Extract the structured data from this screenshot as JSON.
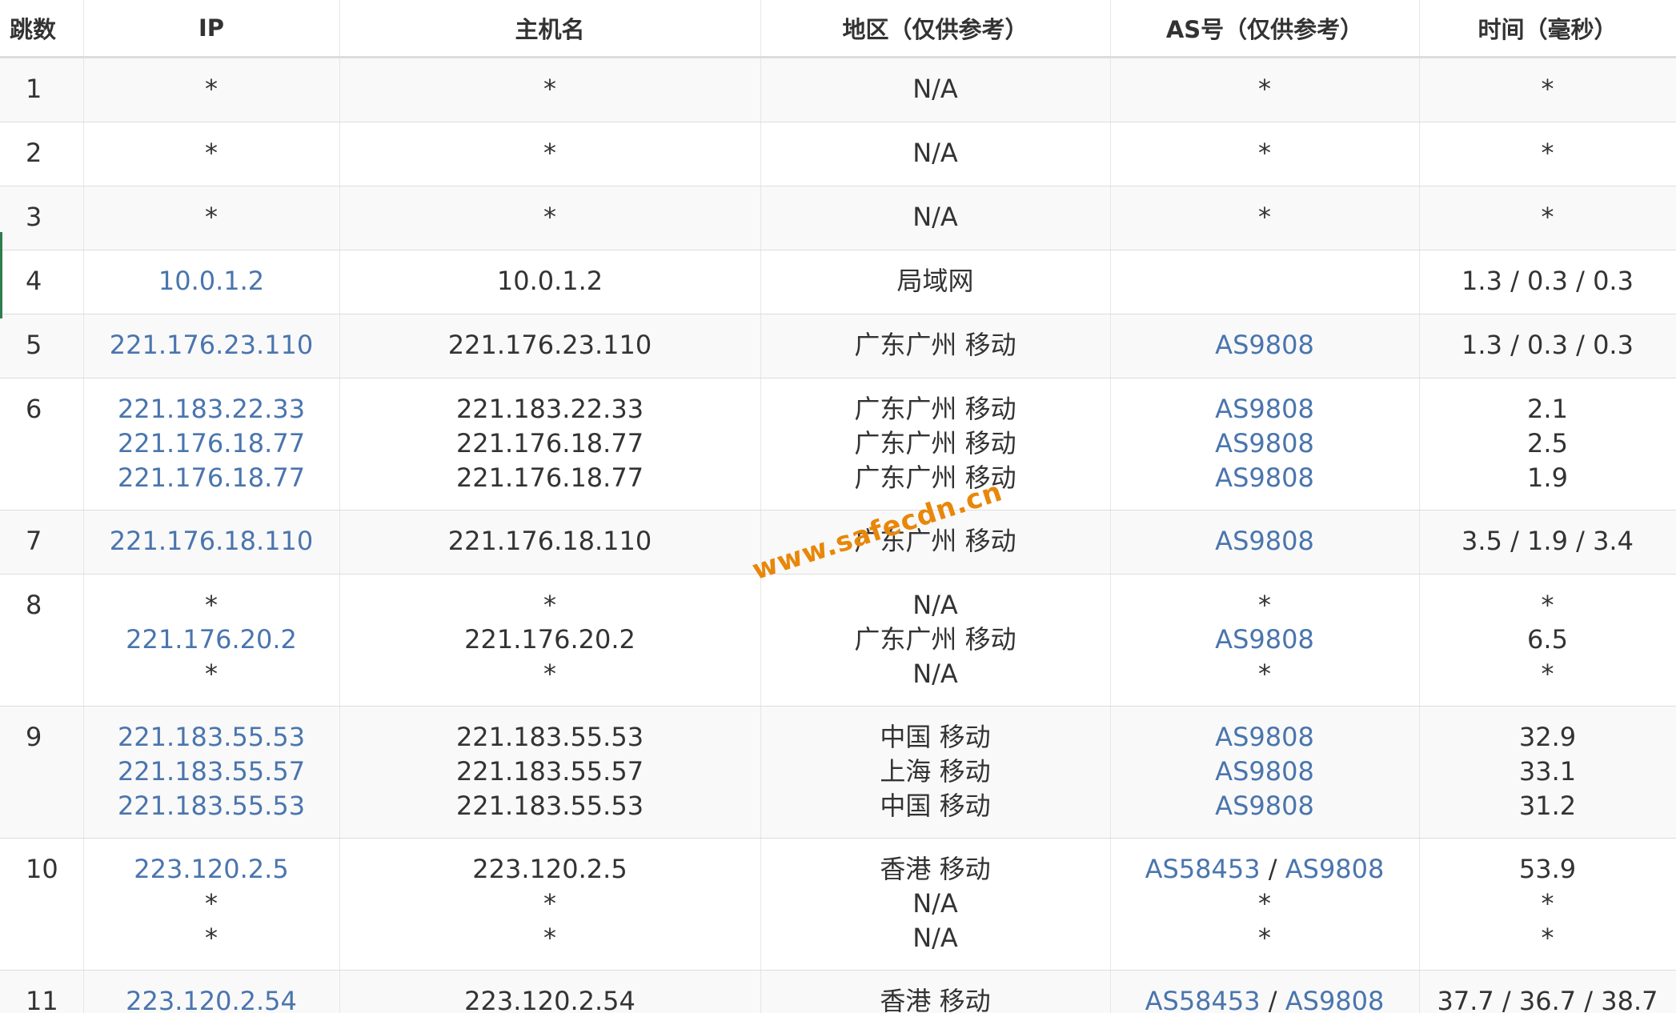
{
  "table": {
    "headers": {
      "hop": "跳数",
      "ip": "IP",
      "host": "主机名",
      "location": "地区（仅供参考）",
      "as": "AS号（仅供参考）",
      "time": "时间（毫秒）"
    },
    "rows": [
      {
        "hop": "1",
        "lines": [
          {
            "ip": "*",
            "host": "*",
            "location": "N/A",
            "as": [
              "*"
            ],
            "time": "*"
          }
        ]
      },
      {
        "hop": "2",
        "lines": [
          {
            "ip": "*",
            "host": "*",
            "location": "N/A",
            "as": [
              "*"
            ],
            "time": "*"
          }
        ]
      },
      {
        "hop": "3",
        "lines": [
          {
            "ip": "*",
            "host": "*",
            "location": "N/A",
            "as": [
              "*"
            ],
            "time": "*"
          }
        ]
      },
      {
        "hop": "4",
        "lines": [
          {
            "ip": "10.0.1.2",
            "host": "10.0.1.2",
            "location": "局域网",
            "as": [],
            "time": "1.3 / 0.3 / 0.3"
          }
        ]
      },
      {
        "hop": "5",
        "lines": [
          {
            "ip": "221.176.23.110",
            "host": "221.176.23.110",
            "location": "广东广州 移动",
            "as": [
              "AS9808"
            ],
            "time": "1.3 / 0.3 / 0.3"
          }
        ]
      },
      {
        "hop": "6",
        "lines": [
          {
            "ip": "221.183.22.33",
            "host": "221.183.22.33",
            "location": "广东广州 移动",
            "as": [
              "AS9808"
            ],
            "time": "2.1"
          },
          {
            "ip": "221.176.18.77",
            "host": "221.176.18.77",
            "location": "广东广州 移动",
            "as": [
              "AS9808"
            ],
            "time": "2.5"
          },
          {
            "ip": "221.176.18.77",
            "host": "221.176.18.77",
            "location": "广东广州 移动",
            "as": [
              "AS9808"
            ],
            "time": "1.9"
          }
        ]
      },
      {
        "hop": "7",
        "lines": [
          {
            "ip": "221.176.18.110",
            "host": "221.176.18.110",
            "location": "广东广州 移动",
            "as": [
              "AS9808"
            ],
            "time": "3.5 / 1.9 / 3.4"
          }
        ]
      },
      {
        "hop": "8",
        "lines": [
          {
            "ip": "*",
            "host": "*",
            "location": "N/A",
            "as": [
              "*"
            ],
            "time": "*"
          },
          {
            "ip": "221.176.20.2",
            "host": "221.176.20.2",
            "location": "广东广州 移动",
            "as": [
              "AS9808"
            ],
            "time": "6.5"
          },
          {
            "ip": "*",
            "host": "*",
            "location": "N/A",
            "as": [
              "*"
            ],
            "time": "*"
          }
        ]
      },
      {
        "hop": "9",
        "lines": [
          {
            "ip": "221.183.55.53",
            "host": "221.183.55.53",
            "location": "中国 移动",
            "as": [
              "AS9808"
            ],
            "time": "32.9"
          },
          {
            "ip": "221.183.55.57",
            "host": "221.183.55.57",
            "location": "上海 移动",
            "as": [
              "AS9808"
            ],
            "time": "33.1"
          },
          {
            "ip": "221.183.55.53",
            "host": "221.183.55.53",
            "location": "中国 移动",
            "as": [
              "AS9808"
            ],
            "time": "31.2"
          }
        ]
      },
      {
        "hop": "10",
        "lines": [
          {
            "ip": "223.120.2.5",
            "host": "223.120.2.5",
            "location": "香港 移动",
            "as": [
              "AS58453",
              "AS9808"
            ],
            "time": "53.9"
          },
          {
            "ip": "*",
            "host": "*",
            "location": "N/A",
            "as": [
              "*"
            ],
            "time": "*"
          },
          {
            "ip": "*",
            "host": "*",
            "location": "N/A",
            "as": [
              "*"
            ],
            "time": "*"
          }
        ]
      },
      {
        "hop": "11",
        "lines": [
          {
            "ip": "223.120.2.54",
            "host": "223.120.2.54",
            "location": "香港 移动",
            "as": [
              "AS58453",
              "AS9808"
            ],
            "time": "37.7 / 36.7 / 38.7"
          }
        ]
      }
    ]
  },
  "as_separator": " / ",
  "watermark": "www.safecdn.cn",
  "colors": {
    "link": "#4a75ad",
    "text": "#333333",
    "row_alt": "#f9f9f9",
    "watermark": "#e8870a"
  }
}
